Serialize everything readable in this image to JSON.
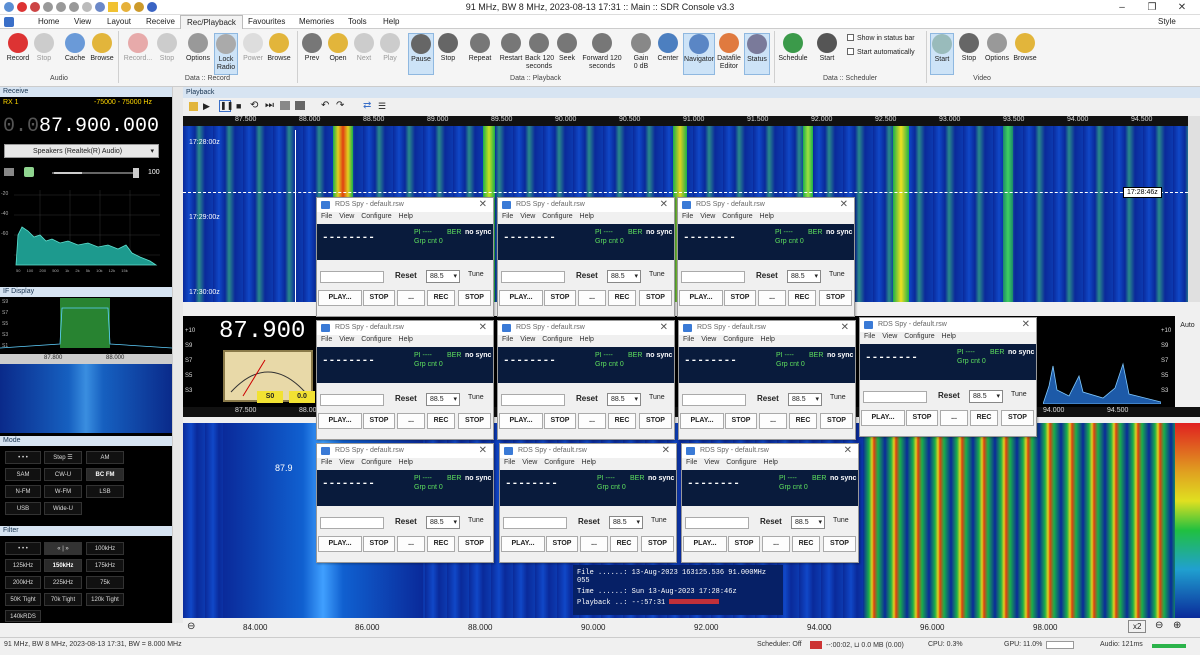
{
  "window": {
    "title": "91 MHz, BW 8 MHz, 2023-08-13 17:31 :: Main :: SDR Console v3.3",
    "style_label": "Style"
  },
  "menu": [
    "Home",
    "View",
    "Layout",
    "Receive",
    "Rec/Playback",
    "Favourites",
    "Memories",
    "Tools",
    "Help"
  ],
  "ribbon": {
    "buttons": [
      {
        "label": "Record"
      },
      {
        "label": "Stop"
      },
      {
        "label": "Cache"
      },
      {
        "label": "Browse"
      },
      {
        "label": "Record..."
      },
      {
        "label": "Stop"
      },
      {
        "label": "Options"
      },
      {
        "label": "Lock\nRadio"
      },
      {
        "label": "Power"
      },
      {
        "label": "Browse"
      },
      {
        "label": "Prev"
      },
      {
        "label": "Open"
      },
      {
        "label": "Next"
      },
      {
        "label": "Play"
      },
      {
        "label": "Pause"
      },
      {
        "label": "Stop"
      },
      {
        "label": "Repeat"
      },
      {
        "label": "Restart"
      },
      {
        "label": "Back 120\nseconds"
      },
      {
        "label": "Seek"
      },
      {
        "label": "Forward 120\nseconds"
      },
      {
        "label": "Gain\n0 dB"
      },
      {
        "label": "Center"
      },
      {
        "label": "Navigator"
      },
      {
        "label": "Datafile\nEditor"
      },
      {
        "label": "Status"
      },
      {
        "label": "Schedule"
      },
      {
        "label": "Start"
      },
      {
        "label": "Start"
      },
      {
        "label": "Stop"
      },
      {
        "label": "Options"
      },
      {
        "label": "Browse"
      }
    ],
    "groups": [
      "Audio",
      "Data :: Record",
      "Data :: Playback",
      "Data :: Scheduler",
      "Video"
    ],
    "show_in_status_bar": "Show in status bar",
    "start_automatically": "Start automatically"
  },
  "left": {
    "receive_header": "Receive",
    "rx_label": "RX 1",
    "rx_range": "-75000 - 75000 Hz",
    "freq_dim": "0.0",
    "freq": "87.900.000",
    "audio_device": "Speakers (Realtek(R) Audio)",
    "volume": "100",
    "spectrum_levels": [
      "-20",
      "-40",
      "-60"
    ],
    "spectrum_x": [
      "50",
      "100",
      "200",
      "500",
      "1k",
      "2k",
      "5k",
      "10k",
      "12k",
      "15k"
    ],
    "if_header": "IF Display",
    "if_levels": [
      "S9",
      "S7",
      "S5",
      "S3",
      "S1"
    ],
    "if_ticks": [
      "87.800",
      "88.000"
    ],
    "mode_header": "Mode",
    "mode_buttons": [
      "• • •",
      "Step ☰",
      "AM",
      "SAM",
      "CW-U",
      "BC FM",
      "N-FM",
      "W-FM",
      "LSB",
      "USB",
      "Wide-U"
    ],
    "filter_header": "Filter",
    "filter_buttons": [
      "• • •",
      "« | »",
      "100kHz",
      "125kHz",
      "150kHz",
      "175kHz",
      "200kHz",
      "225kHz",
      "75k",
      "50K Tight",
      "70k Tight",
      "120k Tight",
      "140kRDS"
    ]
  },
  "playback": {
    "header": "Playback",
    "top_ticks": [
      "87.500",
      "88.000",
      "88.500",
      "89.000",
      "89.500",
      "90.000",
      "90.500",
      "91.000",
      "91.500",
      "92.000",
      "92.500",
      "93.000",
      "93.500",
      "94.000",
      "94.500"
    ],
    "times": [
      "17:28:00z",
      "17:29:00z",
      "17:30:00z"
    ],
    "cursor_time": "17:28:46z",
    "mid_freq": "87.900",
    "mid_levels": [
      "+10",
      "S9",
      "S7",
      "S5",
      "S3"
    ],
    "meter_labels": [
      "S0",
      "0.0"
    ],
    "right_levels": [
      "+10",
      "S9",
      "S7",
      "S5",
      "S3"
    ],
    "mid_ticks": [
      "87.500",
      "88.000",
      "94.000",
      "94.500"
    ],
    "auto_label": "Auto",
    "bottom_marker": "87.9",
    "file_info": [
      {
        "k": "File ......:",
        "v": "13-Aug-2023 163125.536 91.000MHz 055"
      },
      {
        "k": "Time ......:",
        "v": "Sun 13-Aug-2023 17:28:46z"
      },
      {
        "k": "Playback ..:",
        "v": "--:57:31"
      }
    ],
    "bottom_ticks": [
      "84.000",
      "86.000",
      "88.000",
      "90.000",
      "92.000",
      "94.000",
      "96.000",
      "98.000"
    ],
    "zoom": "x2"
  },
  "rds": {
    "title": "RDS Spy - default.rsw",
    "menu": [
      "File",
      "View",
      "Configure",
      "Help"
    ],
    "display": "--------",
    "pi": "PI ----",
    "ber": "BER",
    "nosync": "no sync",
    "grp": "Grp cnt  0",
    "reset": "Reset",
    "freq": "88.5",
    "tune": "Tune",
    "buttons": [
      "PLAY...",
      "STOP",
      "...",
      "REC",
      "STOP"
    ]
  },
  "status": {
    "left": "91 MHz, BW 8 MHz, 2023-08-13 17:31, BW = 8.000 MHz",
    "scheduler": "Scheduler: Off",
    "rec": "--:00:02, ⊔ 0.0 MB (0.00)",
    "cpu": "CPU: 0.3%",
    "gpu": "GPU: 11.0%",
    "audio": "Audio: 121ms"
  }
}
